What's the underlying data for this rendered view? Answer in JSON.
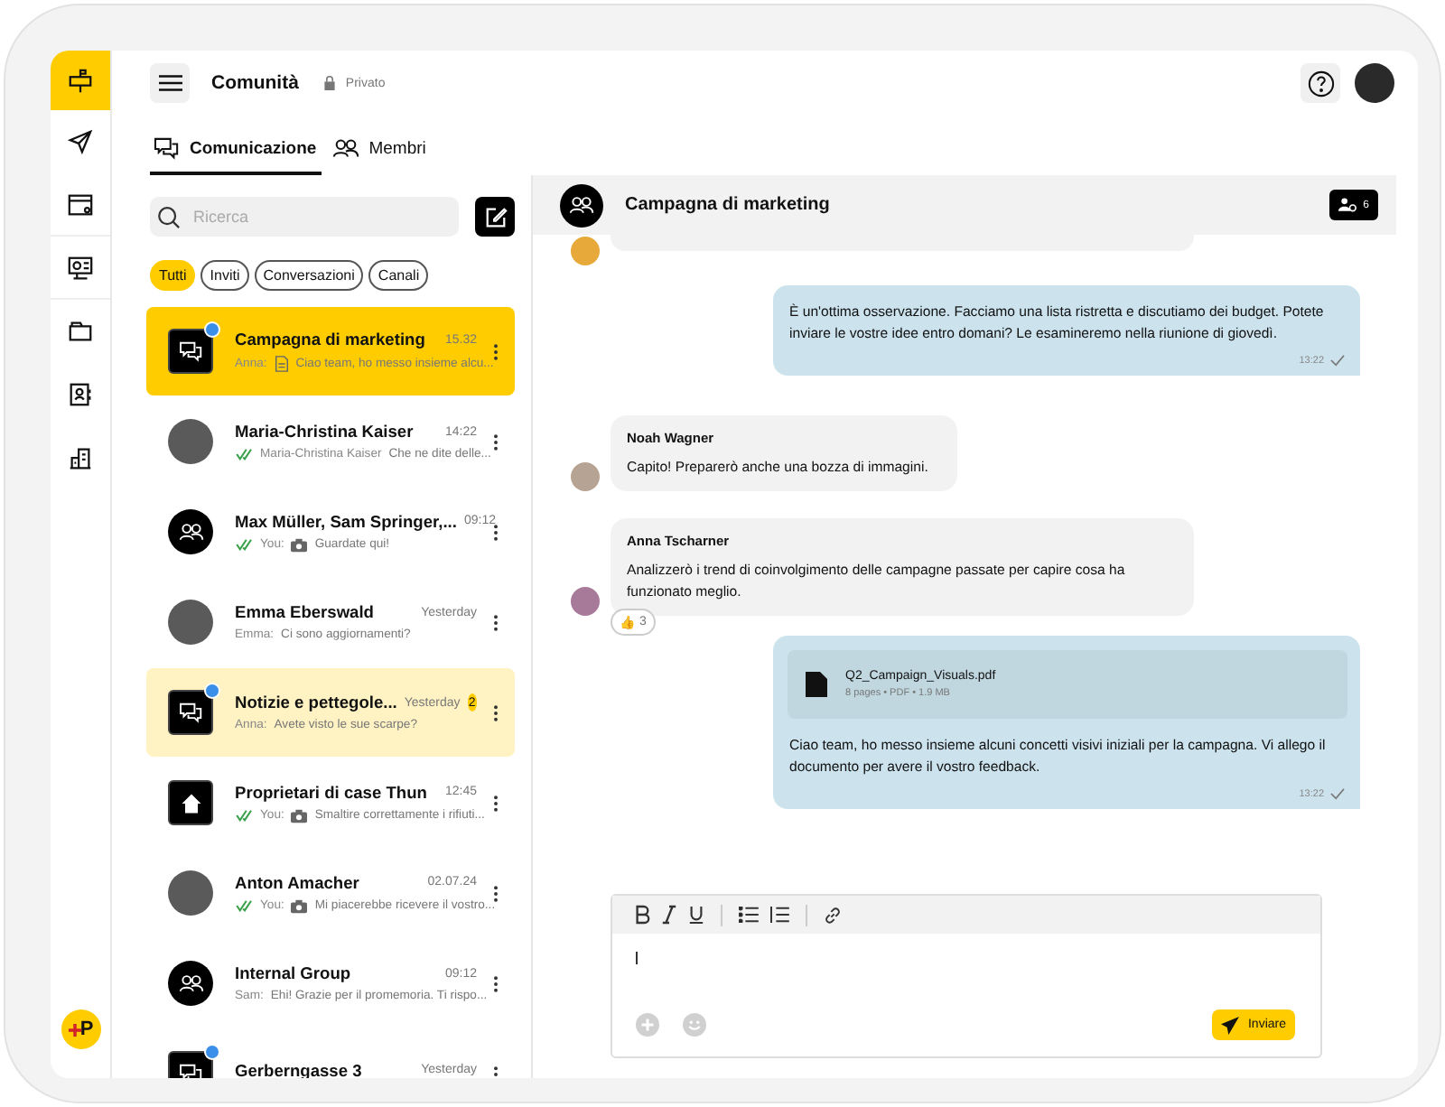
{
  "rail": {
    "items": [
      {
        "selected": true
      },
      {
        "selected": false
      },
      {
        "selected": false
      },
      {
        "selected": false
      },
      {
        "selected": false
      },
      {
        "selected": false
      },
      {
        "selected": false
      }
    ],
    "logo": "P"
  },
  "header": {
    "title": "Comunità",
    "privacy": "Privato"
  },
  "tabs": [
    {
      "label": "Comunicazione",
      "selected": true
    },
    {
      "label": "Membri",
      "selected": false
    }
  ],
  "search": {
    "placeholder": "Ricerca"
  },
  "filters": [
    {
      "label": "Tutti",
      "selected": true
    },
    {
      "label": "Inviti",
      "selected": false
    },
    {
      "label": "Conversazioni",
      "selected": false
    },
    {
      "label": "Canali",
      "selected": false
    }
  ],
  "chats": [
    {
      "name": "Campagna di marketing",
      "time": "15.32",
      "kind": "chat-group",
      "locked": true,
      "selected": true,
      "unread": false,
      "read": false,
      "document": true,
      "photo": false,
      "sender": "Anna:",
      "preview": "Ciao team, ho messo insieme alcu..."
    },
    {
      "name": "Maria-Christina Kaiser",
      "time": "14:22",
      "kind": "person",
      "locked": false,
      "selected": false,
      "unread": false,
      "read": true,
      "document": false,
      "photo": false,
      "sender": "Maria-Christina Kaiser",
      "preview": "Che ne dite delle..."
    },
    {
      "name": "Max Müller, Sam Springer,...",
      "time": "09:12",
      "kind": "people-group",
      "locked": false,
      "selected": false,
      "unread": false,
      "read": true,
      "document": false,
      "photo": true,
      "sender": "You:",
      "preview": "Guardate qui!"
    },
    {
      "name": "Emma Eberswald",
      "time": "Yesterday",
      "kind": "person",
      "locked": false,
      "selected": false,
      "unread": false,
      "read": false,
      "document": false,
      "photo": false,
      "sender": "Emma:",
      "preview": "Ci sono aggiornamenti?"
    },
    {
      "name": "Notizie e pettegole...",
      "time": "Yesterday",
      "count": "2",
      "kind": "chat-group",
      "locked": true,
      "selected": false,
      "unread": true,
      "read": false,
      "document": false,
      "photo": false,
      "sender": "Anna:",
      "preview": "Avete visto le sue scarpe?"
    },
    {
      "name": "Proprietari di case Thun",
      "time": "12:45",
      "kind": "house",
      "locked": false,
      "selected": false,
      "unread": false,
      "read": true,
      "document": false,
      "photo": true,
      "sender": "You:",
      "preview": "Smaltire correttamente i rifiuti..."
    },
    {
      "name": "Anton Amacher",
      "time": "02.07.24",
      "kind": "person",
      "locked": false,
      "selected": false,
      "unread": false,
      "read": true,
      "document": false,
      "photo": true,
      "sender": "You:",
      "preview": "Mi piacerebbe ricevere il vostro..."
    },
    {
      "name": "Internal Group",
      "time": "09:12",
      "kind": "people-group",
      "locked": false,
      "selected": false,
      "unread": false,
      "read": false,
      "document": false,
      "photo": false,
      "sender": "Sam:",
      "preview": "Ehi! Grazie per il promemoria. Ti rispo..."
    },
    {
      "name": "Gerberngasse 3",
      "time": "Yesterday",
      "kind": "chat-group",
      "locked": true,
      "selected": false,
      "unread": false,
      "read": false,
      "document": false,
      "photo": false
    }
  ],
  "conversation": {
    "title": "Campagna di marketing",
    "members": "6",
    "messages": [
      {
        "kind": "clipped"
      },
      {
        "kind": "outgoing",
        "text": "È un'ottima osservazione. Facciamo una lista ristretta e discutiamo dei budget. Potete inviare le vostre idee entro domani? Le esamineremo nella riunione di giovedì.",
        "time": "13:22"
      },
      {
        "kind": "incoming",
        "author": "Noah Wagner",
        "text": "Capito! Preparerò anche una bozza di immagini."
      },
      {
        "kind": "incoming",
        "author": "Anna Tscharner",
        "text": " Analizzerò i trend di coinvolgimento delle campagne passate per capire cosa ha funzionato meglio.",
        "reaction": {
          "emoji": "👍",
          "count": "3"
        }
      },
      {
        "kind": "outgoing",
        "file": "Q2_Campaign_Visuals.pdf",
        "file_meta": "8 pages • PDF • 1.9 MB",
        "text": "Ciao team, ho messo insieme alcuni concetti visivi iniziali per la campagna. Vi allego il documento per avere il vostro feedback.",
        "time": "13:22"
      }
    ]
  },
  "composer": {
    "send": "Inviare"
  }
}
